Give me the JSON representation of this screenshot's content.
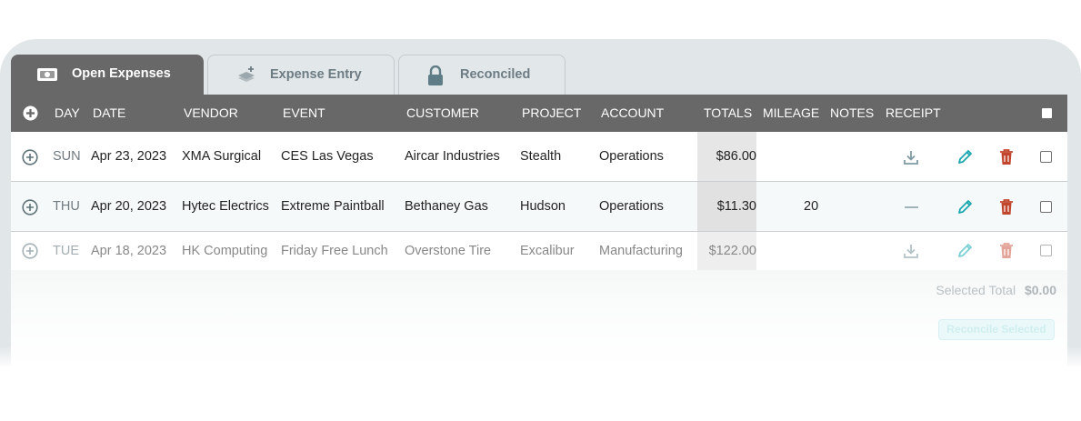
{
  "tabs": [
    {
      "label": "Open Expenses",
      "icon": "cash-icon",
      "active": true
    },
    {
      "label": "Expense Entry",
      "icon": "stack-add-icon",
      "active": false
    },
    {
      "label": "Reconciled",
      "icon": "lock-icon",
      "active": false
    }
  ],
  "columns": {
    "day": "DAY",
    "date": "DATE",
    "vendor": "VENDOR",
    "event": "EVENT",
    "customer": "CUSTOMER",
    "project": "PROJECT",
    "account": "ACCOUNT",
    "totals": "TOTALS",
    "mileage": "MILEAGE",
    "notes": "NOTES",
    "receipt": "RECEIPT"
  },
  "rows": [
    {
      "day": "SUN",
      "date": "Apr 23, 2023",
      "vendor": "XMA Surgical",
      "event": "CES Las Vegas",
      "customer": "Aircar Industries",
      "project": "Stealth",
      "account": "Operations",
      "total": "$86.00",
      "mileage": "",
      "receipt": "download-icon"
    },
    {
      "day": "THU",
      "date": "Apr 20, 2023",
      "vendor": "Hytec Electrics",
      "event": "Extreme Paintball",
      "customer": "Bethaney Gas",
      "project": "Hudson",
      "account": "Operations",
      "total": "$11.30",
      "mileage": "20",
      "receipt": "dash-icon"
    },
    {
      "day": "TUE",
      "date": "Apr 18, 2023",
      "vendor": "HK Computing",
      "event": "Friday Free Lunch",
      "customer": "Overstone Tire",
      "project": "Excalibur",
      "account": "Manufacturing",
      "total": "$122.00",
      "mileage": "",
      "receipt": "download-icon"
    }
  ],
  "footer": {
    "selected_total_label": "Selected Total",
    "selected_total_value": "$0.00",
    "reconcile_label": "Reconcile Selected"
  },
  "colors": {
    "header": "#686868",
    "edit": "#1aa7b0",
    "delete": "#c2452d",
    "accent": "#5f8790"
  }
}
